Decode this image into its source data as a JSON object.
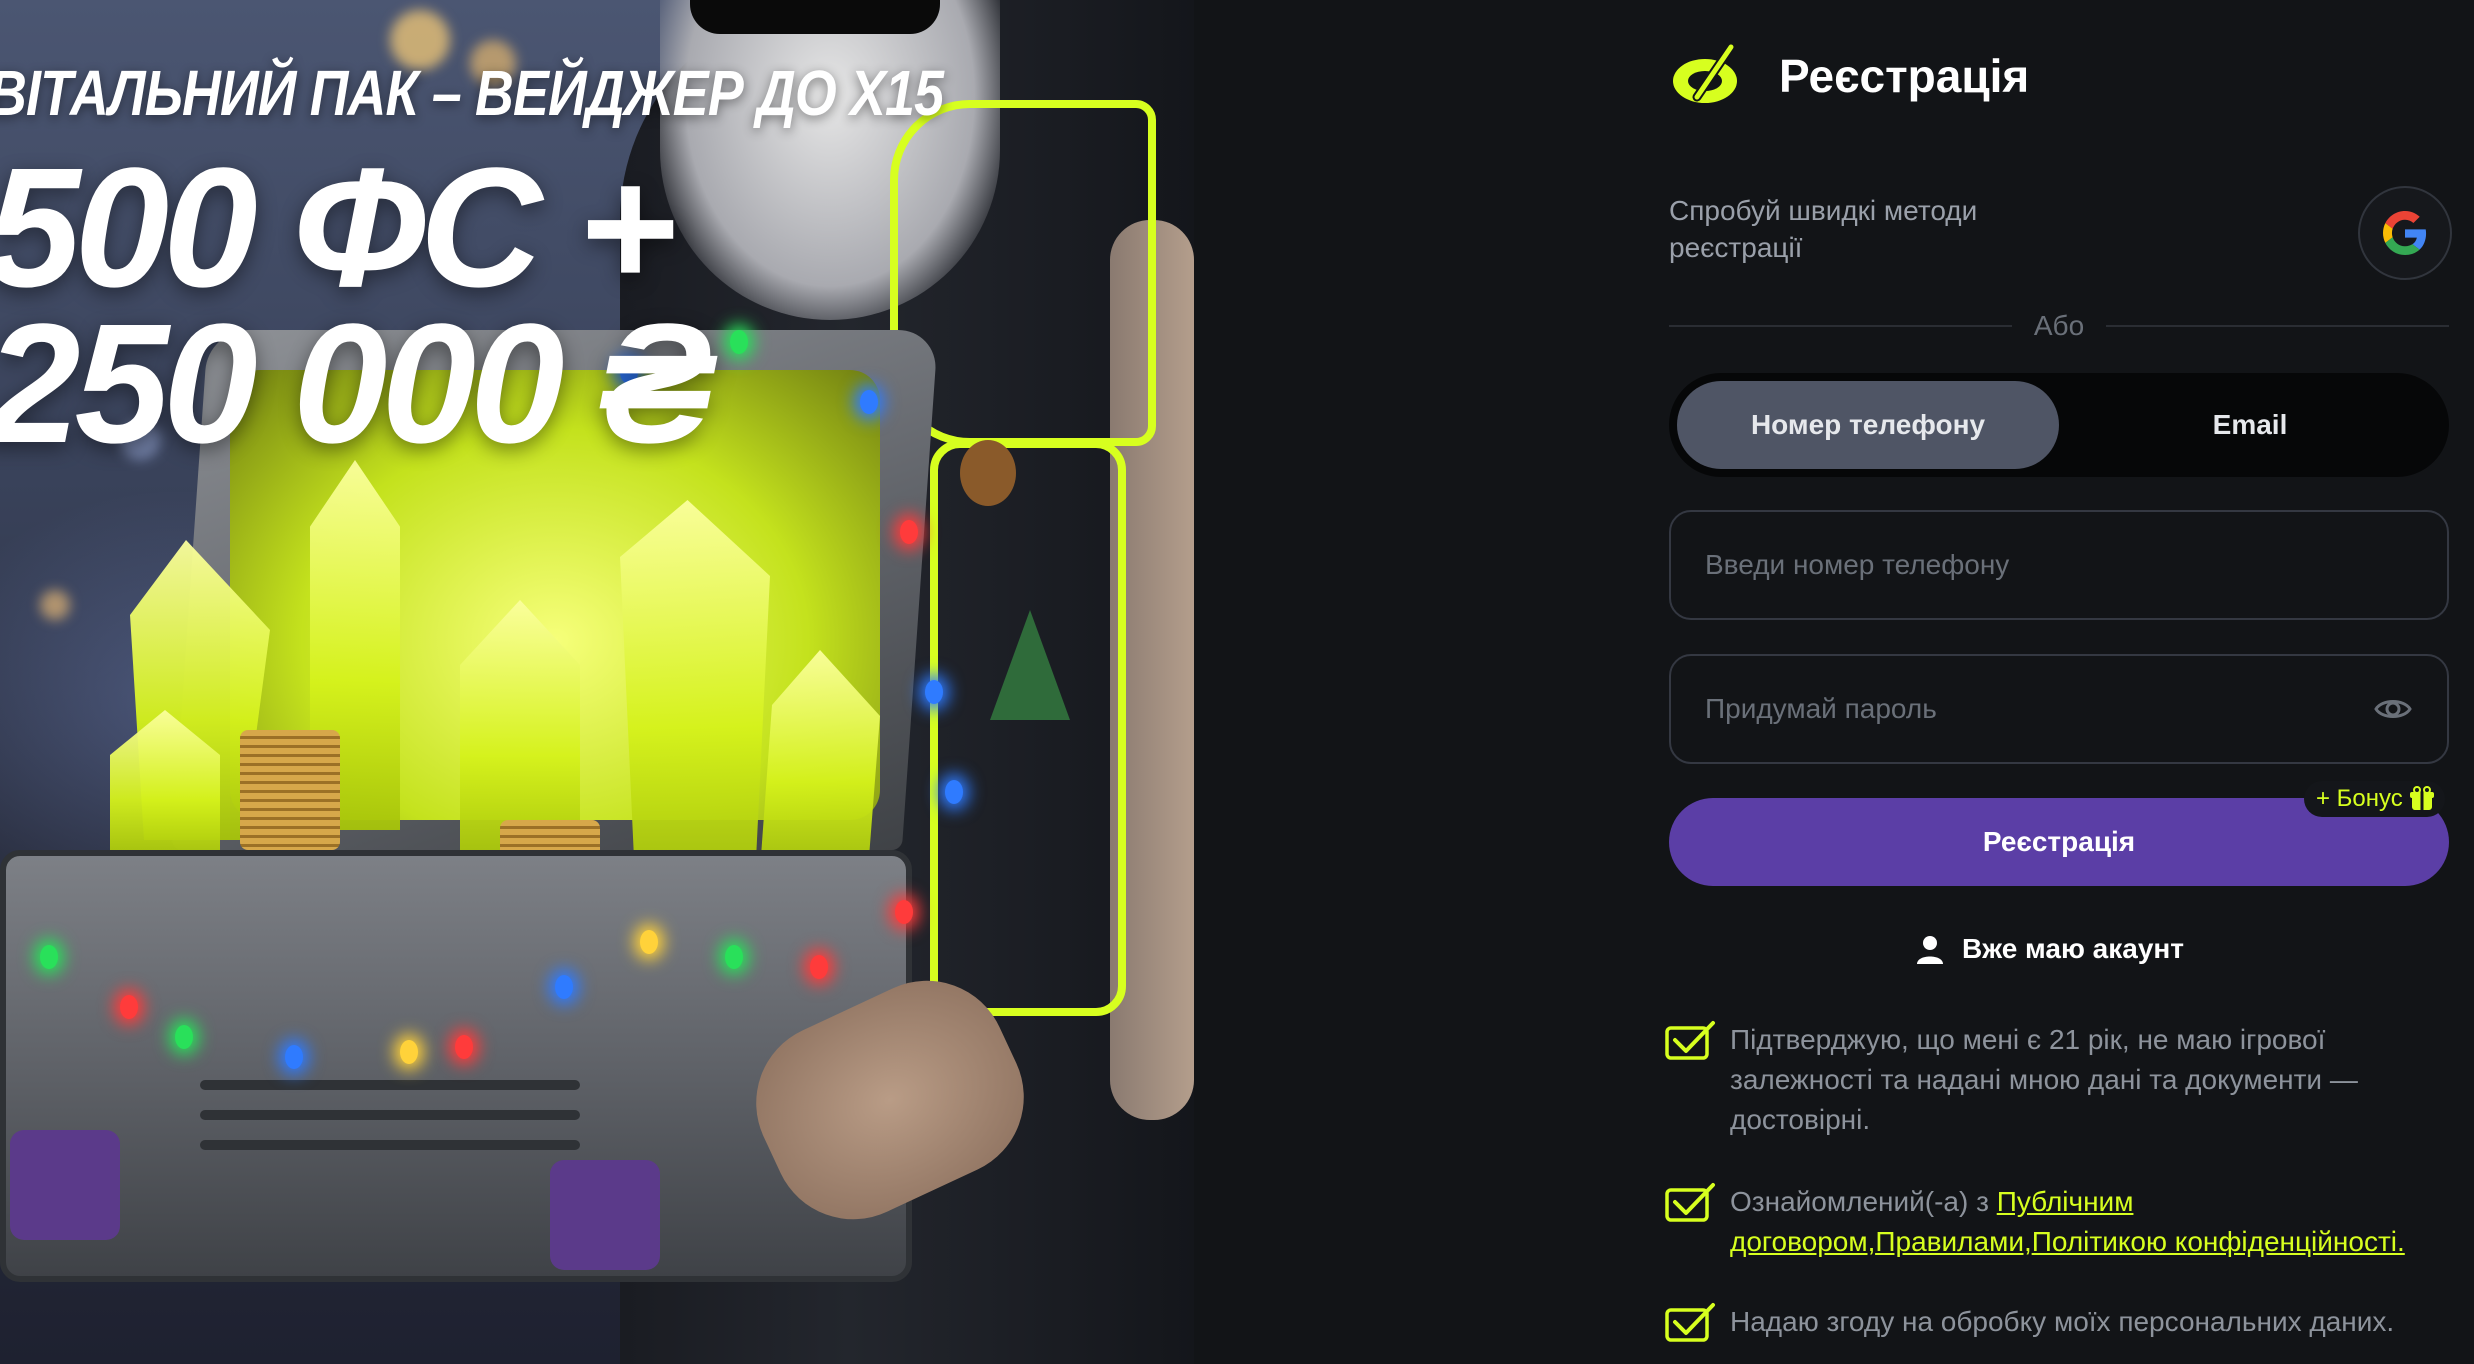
{
  "promo": {
    "subtitle": "ВІТАЛЬНИЙ ПАК – ВЕЙДЖЕР ДО X15",
    "title": "500 ФС + 250 000 ₴"
  },
  "registration": {
    "title": "Реєстрація",
    "quick_methods_text": "Спробуй швидкі методи реєстрації",
    "or_text": "Або",
    "tabs": [
      {
        "label": "Номер телефону",
        "active": true
      },
      {
        "label": "Email",
        "active": false
      }
    ],
    "phone_placeholder": "Введи номер телефону",
    "password_placeholder": "Придумай пароль",
    "bonus_badge": "+ Бонус",
    "submit_label": "Реєстрація",
    "have_account_label": "Вже маю акаунт",
    "consents": {
      "age": "Підтверджую, що мені є 21 рік, не маю ігрової залежності та надані мною дані та документи — достовірні.",
      "rules_prefix": "Ознайомлений(-а) з ",
      "rules_link1": "Публічним договором,",
      "rules_link2": "Правилами,",
      "rules_link3": "Політикою конфіденційності.",
      "personal_data": "Надаю згоду на обробку моїх персональних даних."
    }
  },
  "colors": {
    "accent": "#d7ff1f",
    "primary_button": "#5b3ea6",
    "background": "#121417",
    "active_tab": "#4f5565"
  },
  "icons": [
    "brand-logo-icon",
    "google-icon",
    "eye-icon",
    "gift-icon",
    "user-icon",
    "checkbox-icon"
  ]
}
